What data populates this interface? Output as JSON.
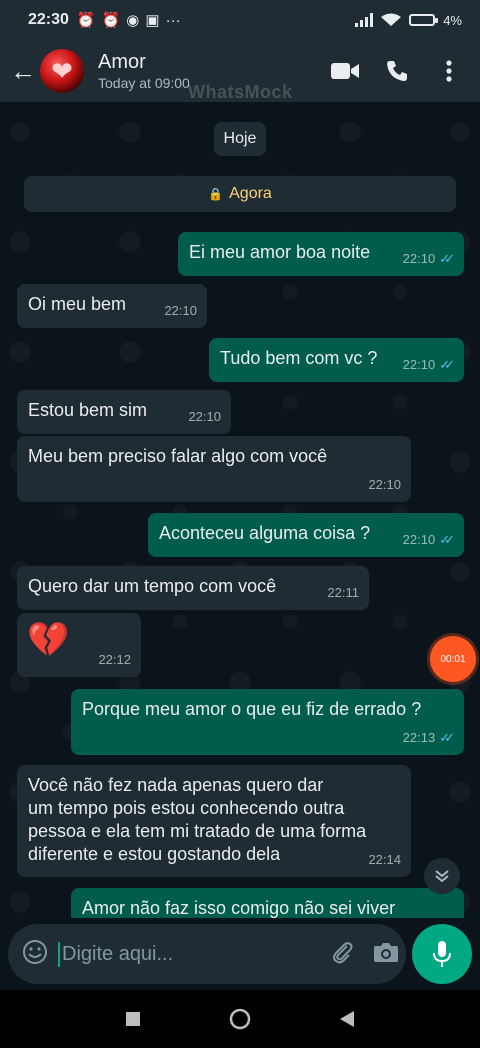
{
  "status_bar": {
    "time": "22:30",
    "icons": [
      "alarm-off-icon",
      "alarm-icon",
      "assistant-icon",
      "work-icon",
      "more-dots-icon"
    ],
    "more": "···",
    "battery": "4%"
  },
  "header": {
    "name": "Amor",
    "last_seen": "Today at 09:00",
    "watermark": "WhatsMock"
  },
  "chat": {
    "date_chip": "Hoje",
    "encryption_chip": "Agora",
    "messages": [
      {
        "dir": "out",
        "text": "Ei meu amor boa noite",
        "time": "22:10"
      },
      {
        "dir": "in",
        "text": "Oi meu bem",
        "time": "22:10"
      },
      {
        "dir": "out",
        "text": "Tudo bem com vc ?",
        "time": "22:10"
      },
      {
        "dir": "in",
        "text": "Estou bem sim",
        "time": "22:10"
      },
      {
        "dir": "in",
        "text": "Meu bem preciso falar algo com você",
        "time": "22:10"
      },
      {
        "dir": "out",
        "text": "Aconteceu alguma coisa ?",
        "time": "22:10"
      },
      {
        "dir": "in",
        "text": "Quero dar um tempo com você",
        "time": "22:11"
      },
      {
        "dir": "in",
        "text": "💔",
        "time": "22:12"
      },
      {
        "dir": "out",
        "text": "Porque meu amor o que eu fiz de errado ?",
        "time": "22:13"
      },
      {
        "dir": "in",
        "text": "Você não fez nada apenas quero dar\num tempo pois estou conhecendo outra\npessoa e ela tem mi tratado de uma forma\ndiferente e estou gostando dela",
        "time": "22:14"
      },
      {
        "dir": "out",
        "text": "Amor não faz isso comigo não sei viver",
        "time": ""
      }
    ],
    "recording_badge": "00:01"
  },
  "input": {
    "placeholder": "Digite aqui..."
  },
  "colors": {
    "outgoing_bubble": "#005c4b",
    "incoming_bubble": "#1f2c34",
    "accent": "#00a884",
    "read_ticks": "#53bdeb",
    "record": "#ff5722"
  }
}
